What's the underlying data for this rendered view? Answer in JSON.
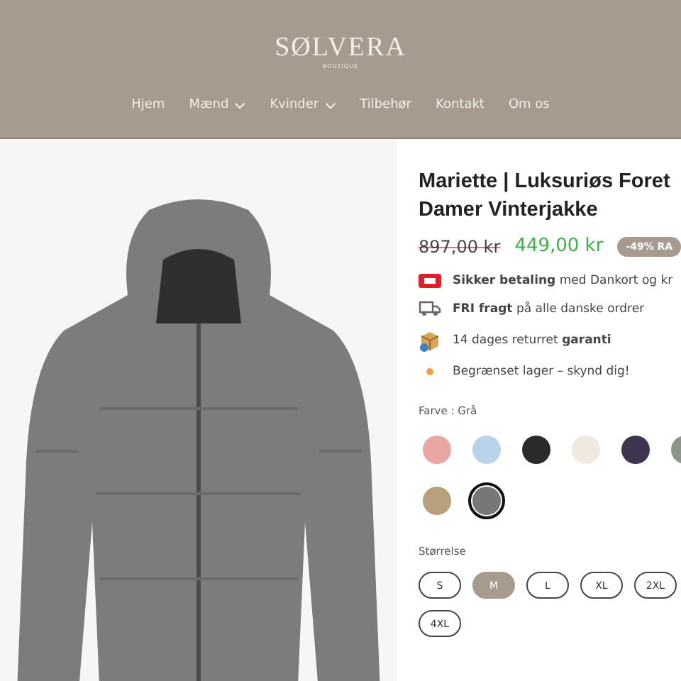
{
  "header": {
    "logo": "SØLVERA",
    "logo_sub": "BOUTIQUE",
    "nav": [
      {
        "label": "Hjem",
        "dropdown": false
      },
      {
        "label": "Mænd",
        "dropdown": true
      },
      {
        "label": "Kvinder",
        "dropdown": true
      },
      {
        "label": "Tilbehør",
        "dropdown": false
      },
      {
        "label": "Kontakt",
        "dropdown": false
      },
      {
        "label": "Om os",
        "dropdown": false
      }
    ]
  },
  "product": {
    "title": "Mariette | Luksuriøs Foret Damer Vinterjakke",
    "old_price": "897,00 kr",
    "price": "449,00 kr",
    "badge": "-49% RA",
    "features": [
      {
        "kind": "card",
        "text": "**Sikker betaling** med Dankort og kr"
      },
      {
        "kind": "truck",
        "text": "**FRI fragt** på alle danske ordrer"
      },
      {
        "kind": "box",
        "text": "14 dages returret **garanti**"
      },
      {
        "kind": "dot",
        "text": "Begrænset lager – skynd dig!"
      }
    ],
    "color_label": "Farve : Grå",
    "swatches": [
      {
        "color": "#e8a7a3",
        "selected": false
      },
      {
        "color": "#b9d3ea",
        "selected": false
      },
      {
        "color": "#2a2a2a",
        "selected": false
      },
      {
        "color": "#efe9e0",
        "selected": false
      },
      {
        "color": "#3e3450",
        "selected": false
      },
      {
        "color": "#8d948a",
        "selected": false
      },
      {
        "color": "#b9a07c",
        "selected": false
      },
      {
        "color": "#77777a",
        "selected": true
      }
    ],
    "size_label": "Størrelse",
    "sizes": [
      {
        "label": "S",
        "selected": false
      },
      {
        "label": "M",
        "selected": true
      },
      {
        "label": "L",
        "selected": false
      },
      {
        "label": "XL",
        "selected": false
      },
      {
        "label": "2XL",
        "selected": false
      },
      {
        "label": "4XL",
        "selected": false
      }
    ]
  }
}
